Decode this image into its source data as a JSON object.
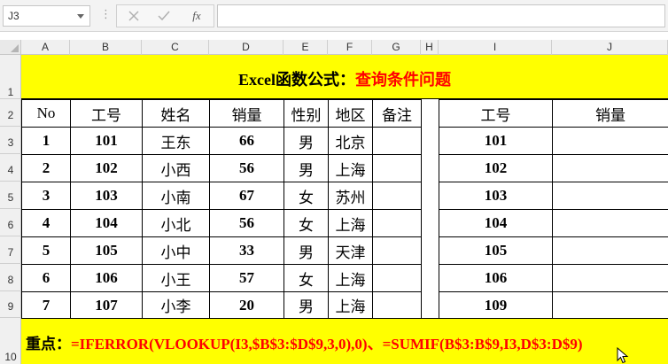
{
  "namebox": {
    "value": "J3"
  },
  "formula_bar": {
    "fx_label": "fx",
    "value": ""
  },
  "columns": [
    "A",
    "B",
    "C",
    "D",
    "E",
    "F",
    "G",
    "H",
    "I",
    "J"
  ],
  "rows": [
    "1",
    "2",
    "3",
    "4",
    "5",
    "6",
    "7",
    "8",
    "9",
    "10"
  ],
  "title": {
    "black": "Excel函数公式：",
    "red": "查询条件问题"
  },
  "left_table": {
    "headers": [
      "No",
      "工号",
      "姓名",
      "销量",
      "性别",
      "地区",
      "备注"
    ],
    "rows": [
      [
        "1",
        "101",
        "王东",
        "66",
        "男",
        "北京",
        ""
      ],
      [
        "2",
        "102",
        "小西",
        "56",
        "男",
        "上海",
        ""
      ],
      [
        "3",
        "103",
        "小南",
        "67",
        "女",
        "苏州",
        ""
      ],
      [
        "4",
        "104",
        "小北",
        "56",
        "女",
        "上海",
        ""
      ],
      [
        "5",
        "105",
        "小中",
        "33",
        "男",
        "天津",
        ""
      ],
      [
        "6",
        "106",
        "小王",
        "57",
        "女",
        "上海",
        ""
      ],
      [
        "7",
        "107",
        "小李",
        "20",
        "男",
        "上海",
        ""
      ]
    ]
  },
  "right_table": {
    "headers": [
      "工号",
      "销量"
    ],
    "rows": [
      [
        "101",
        ""
      ],
      [
        "102",
        ""
      ],
      [
        "103",
        ""
      ],
      [
        "104",
        ""
      ],
      [
        "105",
        ""
      ],
      [
        "106",
        ""
      ],
      [
        "109",
        ""
      ]
    ]
  },
  "footer": {
    "label": "重点：",
    "formula": "=IFERROR(VLOOKUP(I3,$B$3:$D$9,3,0),0)、=SUMIF(B$3:B$9,I3,D$3:D$9)"
  },
  "colors": {
    "band": "#ffff00",
    "red": "#ff0000"
  }
}
